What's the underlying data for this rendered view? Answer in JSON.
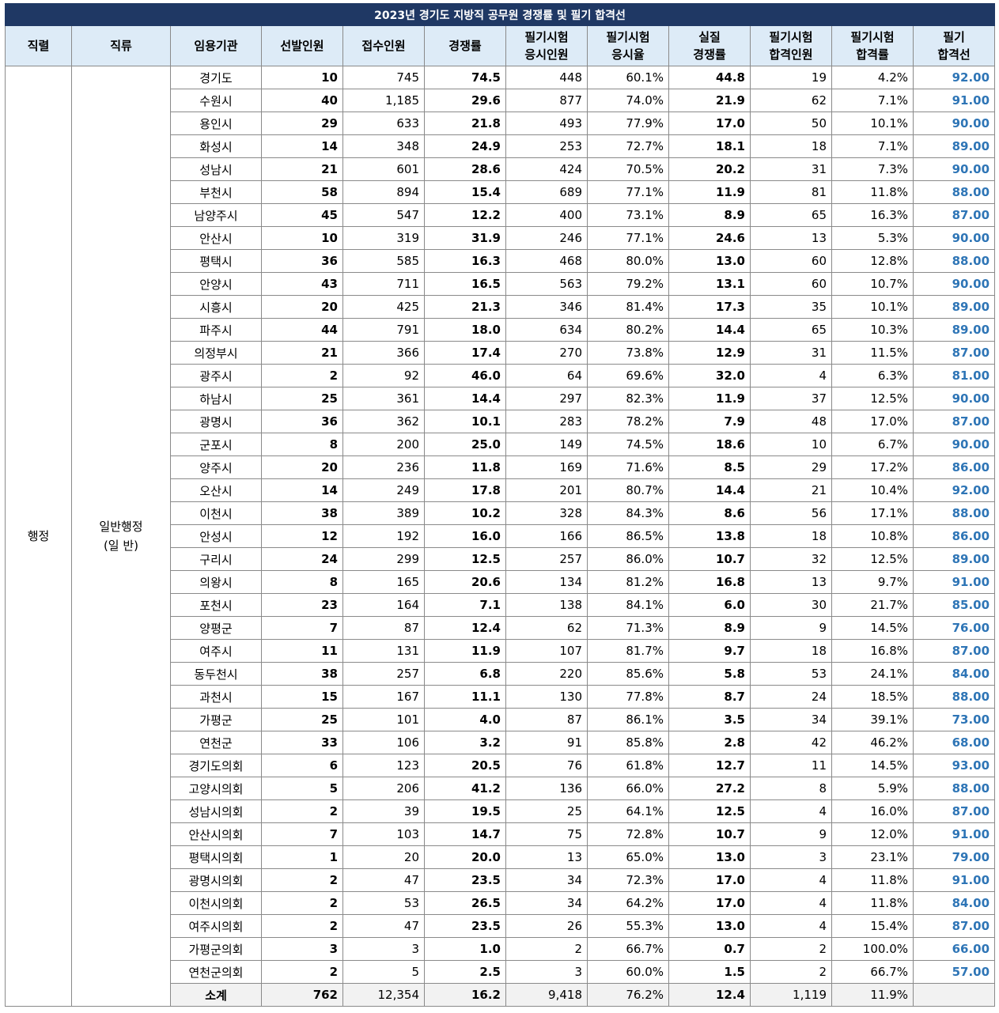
{
  "title": "2023년 경기도 지방직 공무원 경쟁률 및 필기 합격선",
  "headers": [
    "직렬",
    "직류",
    "임용기관",
    "선발인원",
    "접수인원",
    "경쟁률",
    "필기시험\n응시인원",
    "필기시험\n응시율",
    "실질\n경쟁률",
    "필기시험\n합격인원",
    "필기시험\n합격률",
    "필기\n합격선"
  ],
  "series_label": "행정",
  "category_label": "일반행정\n(일 반)",
  "rows": [
    [
      "경기도",
      "10",
      "745",
      "74.5",
      "448",
      "60.1%",
      "44.8",
      "19",
      "4.2%",
      "92.00"
    ],
    [
      "수원시",
      "40",
      "1,185",
      "29.6",
      "877",
      "74.0%",
      "21.9",
      "62",
      "7.1%",
      "91.00"
    ],
    [
      "용인시",
      "29",
      "633",
      "21.8",
      "493",
      "77.9%",
      "17.0",
      "50",
      "10.1%",
      "90.00"
    ],
    [
      "화성시",
      "14",
      "348",
      "24.9",
      "253",
      "72.7%",
      "18.1",
      "18",
      "7.1%",
      "89.00"
    ],
    [
      "성남시",
      "21",
      "601",
      "28.6",
      "424",
      "70.5%",
      "20.2",
      "31",
      "7.3%",
      "90.00"
    ],
    [
      "부천시",
      "58",
      "894",
      "15.4",
      "689",
      "77.1%",
      "11.9",
      "81",
      "11.8%",
      "88.00"
    ],
    [
      "남양주시",
      "45",
      "547",
      "12.2",
      "400",
      "73.1%",
      "8.9",
      "65",
      "16.3%",
      "87.00"
    ],
    [
      "안산시",
      "10",
      "319",
      "31.9",
      "246",
      "77.1%",
      "24.6",
      "13",
      "5.3%",
      "90.00"
    ],
    [
      "평택시",
      "36",
      "585",
      "16.3",
      "468",
      "80.0%",
      "13.0",
      "60",
      "12.8%",
      "88.00"
    ],
    [
      "안양시",
      "43",
      "711",
      "16.5",
      "563",
      "79.2%",
      "13.1",
      "60",
      "10.7%",
      "90.00"
    ],
    [
      "시흥시",
      "20",
      "425",
      "21.3",
      "346",
      "81.4%",
      "17.3",
      "35",
      "10.1%",
      "89.00"
    ],
    [
      "파주시",
      "44",
      "791",
      "18.0",
      "634",
      "80.2%",
      "14.4",
      "65",
      "10.3%",
      "89.00"
    ],
    [
      "의정부시",
      "21",
      "366",
      "17.4",
      "270",
      "73.8%",
      "12.9",
      "31",
      "11.5%",
      "87.00"
    ],
    [
      "광주시",
      "2",
      "92",
      "46.0",
      "64",
      "69.6%",
      "32.0",
      "4",
      "6.3%",
      "81.00"
    ],
    [
      "하남시",
      "25",
      "361",
      "14.4",
      "297",
      "82.3%",
      "11.9",
      "37",
      "12.5%",
      "90.00"
    ],
    [
      "광명시",
      "36",
      "362",
      "10.1",
      "283",
      "78.2%",
      "7.9",
      "48",
      "17.0%",
      "87.00"
    ],
    [
      "군포시",
      "8",
      "200",
      "25.0",
      "149",
      "74.5%",
      "18.6",
      "10",
      "6.7%",
      "90.00"
    ],
    [
      "양주시",
      "20",
      "236",
      "11.8",
      "169",
      "71.6%",
      "8.5",
      "29",
      "17.2%",
      "86.00"
    ],
    [
      "오산시",
      "14",
      "249",
      "17.8",
      "201",
      "80.7%",
      "14.4",
      "21",
      "10.4%",
      "92.00"
    ],
    [
      "이천시",
      "38",
      "389",
      "10.2",
      "328",
      "84.3%",
      "8.6",
      "56",
      "17.1%",
      "88.00"
    ],
    [
      "안성시",
      "12",
      "192",
      "16.0",
      "166",
      "86.5%",
      "13.8",
      "18",
      "10.8%",
      "86.00"
    ],
    [
      "구리시",
      "24",
      "299",
      "12.5",
      "257",
      "86.0%",
      "10.7",
      "32",
      "12.5%",
      "89.00"
    ],
    [
      "의왕시",
      "8",
      "165",
      "20.6",
      "134",
      "81.2%",
      "16.8",
      "13",
      "9.7%",
      "91.00"
    ],
    [
      "포천시",
      "23",
      "164",
      "7.1",
      "138",
      "84.1%",
      "6.0",
      "30",
      "21.7%",
      "85.00"
    ],
    [
      "양평군",
      "7",
      "87",
      "12.4",
      "62",
      "71.3%",
      "8.9",
      "9",
      "14.5%",
      "76.00"
    ],
    [
      "여주시",
      "11",
      "131",
      "11.9",
      "107",
      "81.7%",
      "9.7",
      "18",
      "16.8%",
      "87.00"
    ],
    [
      "동두천시",
      "38",
      "257",
      "6.8",
      "220",
      "85.6%",
      "5.8",
      "53",
      "24.1%",
      "84.00"
    ],
    [
      "과천시",
      "15",
      "167",
      "11.1",
      "130",
      "77.8%",
      "8.7",
      "24",
      "18.5%",
      "88.00"
    ],
    [
      "가평군",
      "25",
      "101",
      "4.0",
      "87",
      "86.1%",
      "3.5",
      "34",
      "39.1%",
      "73.00"
    ],
    [
      "연천군",
      "33",
      "106",
      "3.2",
      "91",
      "85.8%",
      "2.8",
      "42",
      "46.2%",
      "68.00"
    ],
    [
      "경기도의회",
      "6",
      "123",
      "20.5",
      "76",
      "61.8%",
      "12.7",
      "11",
      "14.5%",
      "93.00"
    ],
    [
      "고양시의회",
      "5",
      "206",
      "41.2",
      "136",
      "66.0%",
      "27.2",
      "8",
      "5.9%",
      "88.00"
    ],
    [
      "성남시의회",
      "2",
      "39",
      "19.5",
      "25",
      "64.1%",
      "12.5",
      "4",
      "16.0%",
      "87.00"
    ],
    [
      "안산시의회",
      "7",
      "103",
      "14.7",
      "75",
      "72.8%",
      "10.7",
      "9",
      "12.0%",
      "91.00"
    ],
    [
      "평택시의회",
      "1",
      "20",
      "20.0",
      "13",
      "65.0%",
      "13.0",
      "3",
      "23.1%",
      "79.00"
    ],
    [
      "광명시의회",
      "2",
      "47",
      "23.5",
      "34",
      "72.3%",
      "17.0",
      "4",
      "11.8%",
      "91.00"
    ],
    [
      "이천시의회",
      "2",
      "53",
      "26.5",
      "34",
      "64.2%",
      "17.0",
      "4",
      "11.8%",
      "84.00"
    ],
    [
      "여주시의회",
      "2",
      "47",
      "23.5",
      "26",
      "55.3%",
      "13.0",
      "4",
      "15.4%",
      "87.00"
    ],
    [
      "가평군의회",
      "3",
      "3",
      "1.0",
      "2",
      "66.7%",
      "0.7",
      "2",
      "100.0%",
      "66.00"
    ],
    [
      "연천군의회",
      "2",
      "5",
      "2.5",
      "3",
      "60.0%",
      "1.5",
      "2",
      "66.7%",
      "57.00"
    ]
  ],
  "subtotal": [
    "소계",
    "762",
    "12,354",
    "16.2",
    "9,418",
    "76.2%",
    "12.4",
    "1,119",
    "11.9%",
    ""
  ],
  "colors": {
    "title_bg": "#1f3864",
    "header_bg": "#ddebf7",
    "subtotal_bg": "#f2f2f2",
    "pass_score": "#2e75b6"
  }
}
